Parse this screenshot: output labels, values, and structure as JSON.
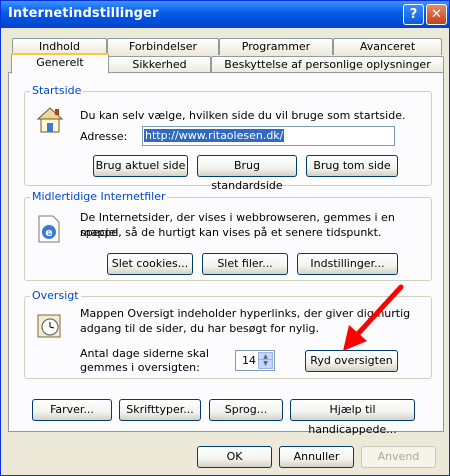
{
  "window": {
    "title": "Internetindstillinger",
    "help_glyph": "?",
    "close_glyph": "✕"
  },
  "tabs_row1": [
    "Indhold",
    "Forbindelser",
    "Programmer",
    "Avanceret"
  ],
  "tabs_row2": [
    "Generelt",
    "Sikkerhed",
    "Beskyttelse af personlige oplysninger"
  ],
  "active_tab": "Generelt",
  "startside": {
    "legend": "Startside",
    "description": "Du kan selv vælge, hvilken side du vil bruge som startside.",
    "address_label": "Adresse:",
    "address_value": "http://www.ritaolesen.dk/",
    "buttons": [
      "Brug aktuel side",
      "Brug standardside",
      "Brug tom side"
    ]
  },
  "tempfiles": {
    "legend": "Midlertidige Internetfiler",
    "description_line1": "De Internetsider, der vises i webbrowseren, gemmes i en speciel",
    "description_line2": "mappe, så de hurtigt kan vises på et senere tidspunkt.",
    "buttons": [
      "Slet cookies...",
      "Slet filer...",
      "Indstillinger..."
    ]
  },
  "history": {
    "legend": "Oversigt",
    "description_line1": "Mappen Oversigt indeholder hyperlinks, der giver dig hurtig",
    "description_line2": "adgang til de sider, du har besøgt for nylig.",
    "days_label_line1": "Antal dage siderne skal",
    "days_label_line2": "gemmes i oversigten:",
    "days_value": "14",
    "clear_button": "Ryd oversigten"
  },
  "bottom_buttons": [
    "Farver...",
    "Skrifttyper...",
    "Sprog...",
    "Hjælp til handicappede..."
  ],
  "dialog_buttons": {
    "ok": "OK",
    "cancel": "Annuller",
    "apply": "Anvend"
  },
  "colors": {
    "title_bar": "#0054e3",
    "legend": "#0046d5",
    "selection": "#316ac5",
    "arrow": "#ff0000"
  }
}
